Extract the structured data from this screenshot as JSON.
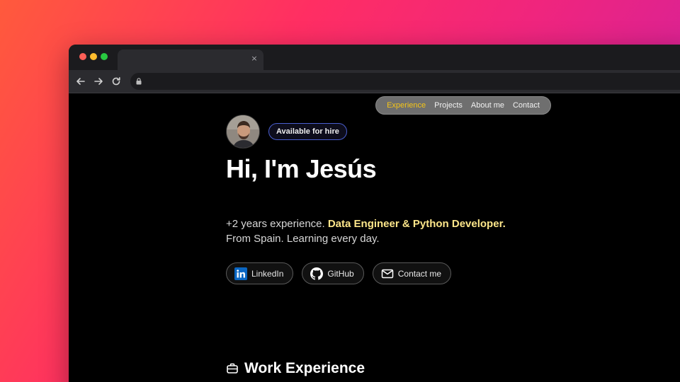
{
  "browser": {
    "tab": {
      "title": "",
      "close_icon": "×"
    },
    "address": ""
  },
  "nav": {
    "items": [
      {
        "label": "Experience",
        "active": true
      },
      {
        "label": "Projects",
        "active": false
      },
      {
        "label": "About me",
        "active": false
      },
      {
        "label": "Contact",
        "active": false
      }
    ]
  },
  "profile": {
    "badge": "Available for hire",
    "title": "Hi, I'm Jesús",
    "intro_prefix": "+2 years experience.",
    "intro_highlight": "Data Engineer & Python Developer.",
    "intro_line2": "From Spain. Learning every day."
  },
  "links": [
    {
      "label": "LinkedIn",
      "icon": "linkedin-icon"
    },
    {
      "label": "GitHub",
      "icon": "github-icon"
    },
    {
      "label": "Contact me",
      "icon": "mail-icon"
    }
  ],
  "sections": {
    "work_experience": {
      "title": "Work Experience",
      "icon": "briefcase-icon"
    }
  },
  "colors": {
    "accent_active_nav": "#f5c518",
    "highlight_text": "#fde68a",
    "badge_border": "#4a5fd0",
    "linkedin_blue": "#0a66c2"
  }
}
